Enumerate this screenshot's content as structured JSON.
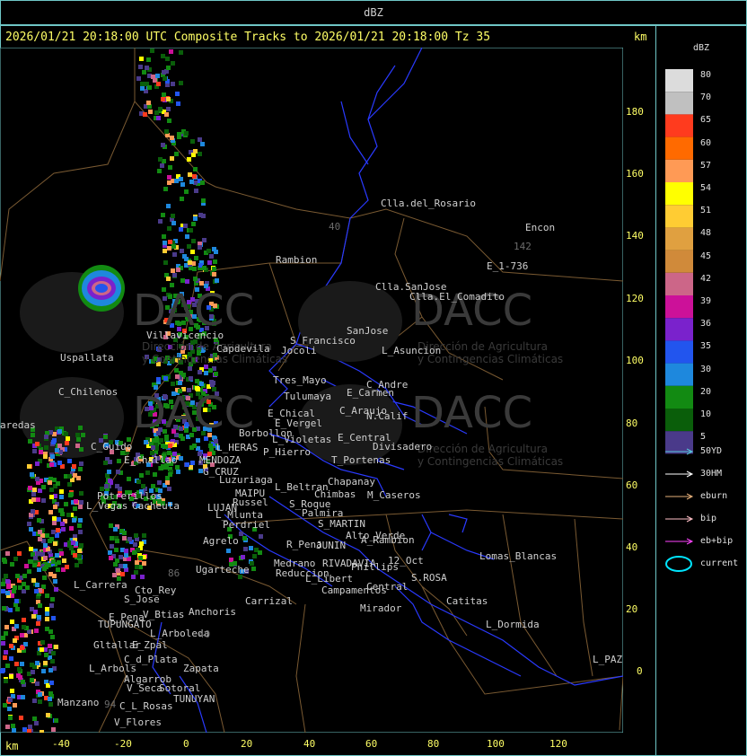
{
  "header": {
    "title": "dBZ"
  },
  "map": {
    "status_line": "2026/01/21 20:18:00 UTC Composite Tracks to 2026/01/21 20:18:00 Tz 35",
    "unit_top": "km",
    "unit_bottom": "km",
    "y_ticks": [
      "180",
      "160",
      "140",
      "120",
      "100",
      "80",
      "60",
      "40",
      "20",
      "0"
    ],
    "x_ticks": [
      "-40",
      "-20",
      "0",
      "20",
      "40",
      "60",
      "80",
      "100",
      "120"
    ],
    "watermark": {
      "logo": "DACC",
      "line1": "Dirección de Agricultura",
      "line2": "y Contingencias Climáticas"
    },
    "places": [
      {
        "name": "Clla.del_Rosario"
      },
      {
        "name": "Encon"
      },
      {
        "name": "142"
      },
      {
        "name": "E_1-736"
      },
      {
        "name": "Rambion"
      },
      {
        "name": "Clla.SanJose"
      },
      {
        "name": "Clla.El_Comadito"
      },
      {
        "name": "Villavicencio"
      },
      {
        "name": "Capdevila"
      },
      {
        "name": "S_Francisco"
      },
      {
        "name": "Jocoli"
      },
      {
        "name": "SanJose"
      },
      {
        "name": "L_Asuncion"
      },
      {
        "name": "Uspallata"
      },
      {
        "name": "Tres_Mayo"
      },
      {
        "name": "C_Andre"
      },
      {
        "name": "C_Chilenos"
      },
      {
        "name": "Tulumaya"
      },
      {
        "name": "E_Carmen"
      },
      {
        "name": "E_Chical"
      },
      {
        "name": "C_Araujo"
      },
      {
        "name": "N.Calif"
      },
      {
        "name": "E_Vergel"
      },
      {
        "name": "Borbollon"
      },
      {
        "name": "L_Violetas"
      },
      {
        "name": "E_Central"
      },
      {
        "name": "Divisadero"
      },
      {
        "name": "aredas"
      },
      {
        "name": "C_Guido"
      },
      {
        "name": "L_HERAS"
      },
      {
        "name": "P_Hierro"
      },
      {
        "name": "T_Portenas"
      },
      {
        "name": "E_Challao"
      },
      {
        "name": "MENDOZA"
      },
      {
        "name": "G_CRUZ"
      },
      {
        "name": "Luzuriaga"
      },
      {
        "name": "Chapanay"
      },
      {
        "name": "L_Beltran"
      },
      {
        "name": "Chimbas"
      },
      {
        "name": "M_Caseros"
      },
      {
        "name": "Potrerillos"
      },
      {
        "name": "MAIPU"
      },
      {
        "name": "Russel"
      },
      {
        "name": "L_Vegas"
      },
      {
        "name": "Cacheuta"
      },
      {
        "name": "LUJAN"
      },
      {
        "name": "S_Roque"
      },
      {
        "name": "L_Mlunta"
      },
      {
        "name": "Palmira"
      },
      {
        "name": "Perdriel"
      },
      {
        "name": "S_MARTIN"
      },
      {
        "name": "Alto_Verde"
      },
      {
        "name": "Agrelo"
      },
      {
        "name": "R_Pena"
      },
      {
        "name": "JUNIN"
      },
      {
        "name": "A_Rambion"
      },
      {
        "name": "Lomas_Blancas"
      },
      {
        "name": "Medrano"
      },
      {
        "name": "RIVADAVIA"
      },
      {
        "name": "12_Oct"
      },
      {
        "name": "Ugarteche"
      },
      {
        "name": "Phillips"
      },
      {
        "name": "Reduccion"
      },
      {
        "name": "L_Libert"
      },
      {
        "name": "S.ROSA"
      },
      {
        "name": "L_Carrera"
      },
      {
        "name": "Cto_Rey"
      },
      {
        "name": "Campamentos"
      },
      {
        "name": "Central"
      },
      {
        "name": "S_Jose"
      },
      {
        "name": "Carrizal"
      },
      {
        "name": "Catitas"
      },
      {
        "name": "Anchoris"
      },
      {
        "name": "V_Btias"
      },
      {
        "name": "Mirador"
      },
      {
        "name": "E_Pena"
      },
      {
        "name": "TUPUNGATO"
      },
      {
        "name": "L_Dormida"
      },
      {
        "name": "L_Arboleda"
      },
      {
        "name": "Gltallar"
      },
      {
        "name": "E_Zpal"
      },
      {
        "name": "C_d_Plata"
      },
      {
        "name": "L_PAZ"
      },
      {
        "name": "L_Arbols"
      },
      {
        "name": "Zapata"
      },
      {
        "name": "Algarrob"
      },
      {
        "name": "V_Seca"
      },
      {
        "name": "Sotoral"
      },
      {
        "name": "TUNUYAN"
      },
      {
        "name": "Manzano"
      },
      {
        "name": "94"
      },
      {
        "name": "C_L_Rosas"
      },
      {
        "name": "V_Flores"
      },
      {
        "name": "40"
      },
      {
        "name": "86"
      },
      {
        "name": "40"
      }
    ]
  },
  "legend": {
    "title": "dBZ",
    "scale": [
      {
        "label": "80",
        "color": "#dcdcdc"
      },
      {
        "label": "70",
        "color": "#c0c0c0"
      },
      {
        "label": "65",
        "color": "#ff3b1e"
      },
      {
        "label": "60",
        "color": "#ff6a00"
      },
      {
        "label": "57",
        "color": "#ff9a55"
      },
      {
        "label": "54",
        "color": "#ffff00"
      },
      {
        "label": "51",
        "color": "#ffcc33"
      },
      {
        "label": "48",
        "color": "#e0a040"
      },
      {
        "label": "45",
        "color": "#d08a3a"
      },
      {
        "label": "42",
        "color": "#cc6688"
      },
      {
        "label": "39",
        "color": "#cc1199"
      },
      {
        "label": "36",
        "color": "#7a22cc"
      },
      {
        "label": "35",
        "color": "#2255ee"
      },
      {
        "label": "30",
        "color": "#1e88dd"
      },
      {
        "label": "20",
        "color": "#128a12"
      },
      {
        "label": "10",
        "color": "#0a5e0a"
      },
      {
        "label": "5",
        "color": "#4a3a8a"
      }
    ],
    "tracks": [
      {
        "label": "50YD",
        "color": "#55c8d8",
        "kind": "arrow"
      },
      {
        "label": "30HM",
        "color": "#ffffff",
        "kind": "arrow"
      },
      {
        "label": "eburn",
        "color": "#e6b07a",
        "kind": "arrow"
      },
      {
        "label": "bip",
        "color": "#ffc0c8",
        "kind": "arrow"
      },
      {
        "label": "eb+bip",
        "color": "#ff44ff",
        "kind": "arrow"
      },
      {
        "label": "current",
        "color": "#00e5ff",
        "kind": "ellipse"
      }
    ]
  }
}
